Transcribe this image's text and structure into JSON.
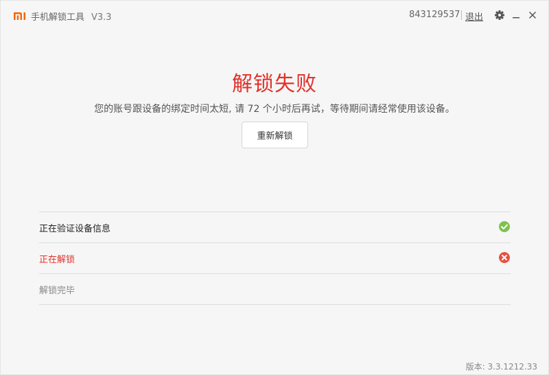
{
  "header": {
    "logo": "mi-logo",
    "app_name": "手机解锁工具",
    "version": "V3.3",
    "account_id": "843129537",
    "logout_label": "退出",
    "icons": [
      "gear-icon",
      "minimize-icon",
      "close-icon"
    ]
  },
  "result": {
    "title": "解锁失败",
    "description": "您的账号跟设备的绑定时间太短, 请 72 个小时后再试，等待期间请经常使用该设备。",
    "retry_label": "重新解锁"
  },
  "steps": [
    {
      "label": "正在验证设备信息",
      "status": "success",
      "icon": "check-circle-icon"
    },
    {
      "label": "正在解锁",
      "status": "failed",
      "icon": "error-circle-icon"
    },
    {
      "label": "解锁完毕",
      "status": "pending",
      "icon": ""
    }
  ],
  "footer": {
    "version_text": "版本: 3.3.1212.33"
  },
  "colors": {
    "brand": "#f56600",
    "error": "#e2322b",
    "success": "#7ec24f"
  }
}
